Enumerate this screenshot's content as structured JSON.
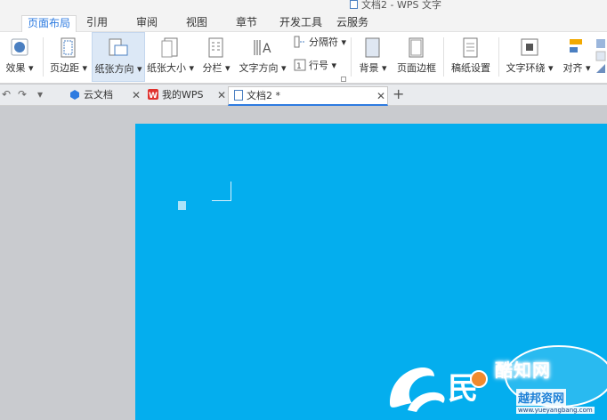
{
  "window": {
    "title": "文档2 - WPS 文字"
  },
  "menu": {
    "tabs": [
      {
        "label": "页面布局",
        "active": true
      },
      {
        "label": "引用"
      },
      {
        "label": "审阅"
      },
      {
        "label": "视图"
      },
      {
        "label": "章节"
      },
      {
        "label": "开发工具"
      },
      {
        "label": "云服务"
      }
    ]
  },
  "ribbon": {
    "effects": "效果",
    "margins": "页边距",
    "orientation": "纸张方向",
    "size": "纸张大小",
    "columns": "分栏",
    "text_direction": "文字方向",
    "breaks": "分隔符",
    "line_numbers": "行号",
    "background": "背景",
    "page_border": "页面边框",
    "manuscript": "稿纸设置",
    "wrap": "文字环绕",
    "align": "对齐"
  },
  "tabs": {
    "items": [
      {
        "label": "云文档",
        "icon": "cloud-docs-icon"
      },
      {
        "label": "我的WPS",
        "icon": "wps-logo-icon"
      },
      {
        "label": "文档2 *",
        "icon": "document-icon",
        "active": true
      }
    ]
  },
  "watermark": {
    "brand": "酷知网",
    "sub": "越邦资网",
    "url": "www.yueyangbang.com"
  },
  "colors": {
    "accent": "#2d7be0",
    "page": "#04aeee",
    "workspace": "#c9cbcf"
  }
}
